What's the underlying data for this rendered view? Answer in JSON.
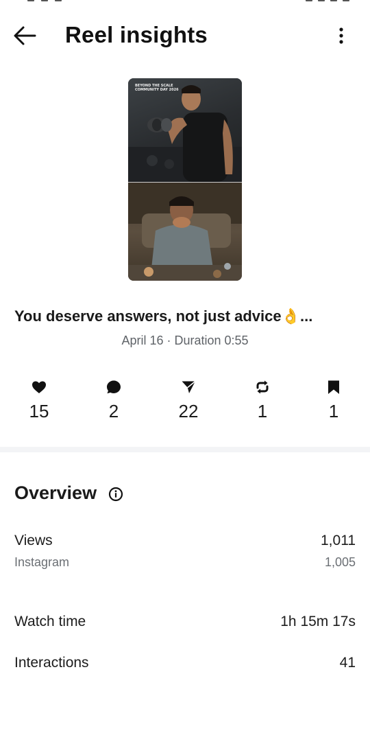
{
  "header": {
    "title": "Reel insights"
  },
  "thumbnail": {
    "overlay_text": "BEYOND THE SCALE COMMUNITY DAY 2026"
  },
  "reel": {
    "caption": "You deserve answers, not just advice👌...",
    "meta": "April 16 · Duration 0:55"
  },
  "stats": {
    "likes": "15",
    "comments": "2",
    "shares": "22",
    "reposts": "1",
    "saves": "1"
  },
  "overview": {
    "title": "Overview",
    "views_label": "Views",
    "views_value": "1,011",
    "instagram_label": "Instagram",
    "instagram_value": "1,005",
    "watch_time_label": "Watch time",
    "watch_time_value": "1h 15m 17s",
    "interactions_label": "Interactions",
    "interactions_value": "41"
  },
  "icons": {
    "back": "arrow-left-icon",
    "more": "more-vertical-icon",
    "like": "heart-icon",
    "comment": "comment-bubble-icon",
    "share": "send-icon",
    "repost": "repost-icon",
    "save": "bookmark-icon",
    "info": "info-icon"
  }
}
